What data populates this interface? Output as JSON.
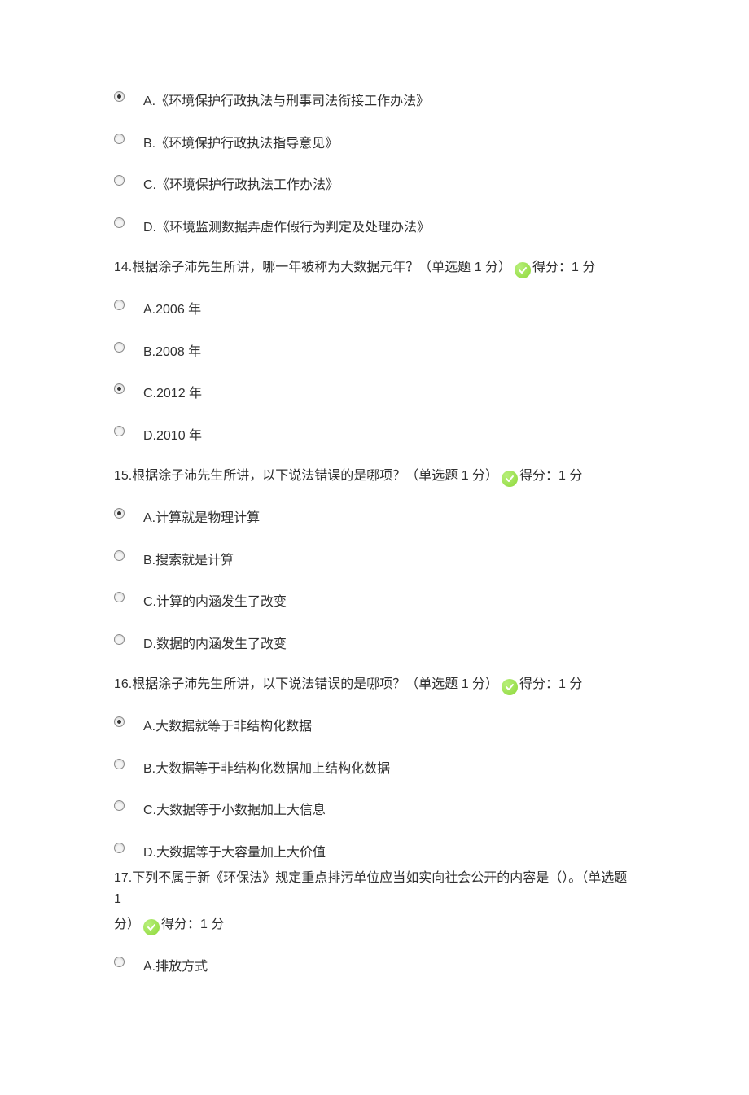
{
  "q13": {
    "options": [
      {
        "label": "A.《环境保护行政执法与刑事司法衔接工作办法》",
        "selected": true
      },
      {
        "label": "B.《环境保护行政执法指导意见》",
        "selected": false
      },
      {
        "label": "C.《环境保护行政执法工作办法》",
        "selected": false
      },
      {
        "label": "D.《环境监测数据弄虚作假行为判定及处理办法》",
        "selected": false
      }
    ]
  },
  "q14": {
    "stem": "14.根据涂子沛先生所讲，哪一年被称为大数据元年？（单选题 1 分）",
    "score": "得分：1 分",
    "options": [
      {
        "label": "A.2006 年",
        "selected": false
      },
      {
        "label": "B.2008 年",
        "selected": false
      },
      {
        "label": "C.2012 年",
        "selected": true
      },
      {
        "label": "D.2010 年",
        "selected": false
      }
    ]
  },
  "q15": {
    "stem": "15.根据涂子沛先生所讲，以下说法错误的是哪项？（单选题 1 分）",
    "score": "得分：1 分",
    "options": [
      {
        "label": "A.计算就是物理计算",
        "selected": true
      },
      {
        "label": "B.搜索就是计算",
        "selected": false
      },
      {
        "label": "C.计算的内涵发生了改变",
        "selected": false
      },
      {
        "label": "D.数据的内涵发生了改变",
        "selected": false
      }
    ]
  },
  "q16": {
    "stem": "16.根据涂子沛先生所讲，以下说法错误的是哪项？（单选题 1 分）",
    "score": "得分：1 分",
    "options": [
      {
        "label": "A.大数据就等于非结构化数据",
        "selected": true
      },
      {
        "label": "B.大数据等于非结构化数据加上结构化数据",
        "selected": false
      },
      {
        "label": "C.大数据等于小数据加上大信息",
        "selected": false
      },
      {
        "label": "D.大数据等于大容量加上大价值",
        "selected": false
      }
    ]
  },
  "q17": {
    "stem1": "17.下列不属于新《环保法》规定重点排污单位应当如实向社会公开的内容是（）。（单选题 1",
    "stem2": "分）",
    "score": "得分：1 分",
    "options": [
      {
        "label": "A.排放方式",
        "selected": false
      }
    ]
  }
}
